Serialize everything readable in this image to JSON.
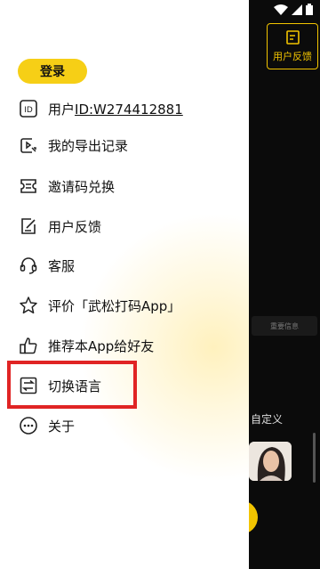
{
  "background_app": {
    "feedback_label": "用户反馈",
    "tab_hint": "重要信息",
    "custom_text": "自定义"
  },
  "drawer": {
    "login_label": "登录",
    "user_label": "用户",
    "user_id": "ID:W274412881",
    "items": [
      {
        "label": "我的导出记录",
        "icon": "export-record-icon"
      },
      {
        "label": "邀请码兑换",
        "icon": "ticket-icon"
      },
      {
        "label": "用户反馈",
        "icon": "feedback-icon"
      },
      {
        "label": "客服",
        "icon": "headset-icon"
      },
      {
        "label": "评价「武松打码App」",
        "icon": "star-icon"
      },
      {
        "label": "推荐本App给好友",
        "icon": "thumbs-up-icon"
      },
      {
        "label": "切换语言",
        "icon": "switch-language-icon"
      },
      {
        "label": "关于",
        "icon": "more-icon"
      }
    ]
  },
  "colors": {
    "accent_yellow": "#f6cf16",
    "highlight_red": "#e02424"
  }
}
